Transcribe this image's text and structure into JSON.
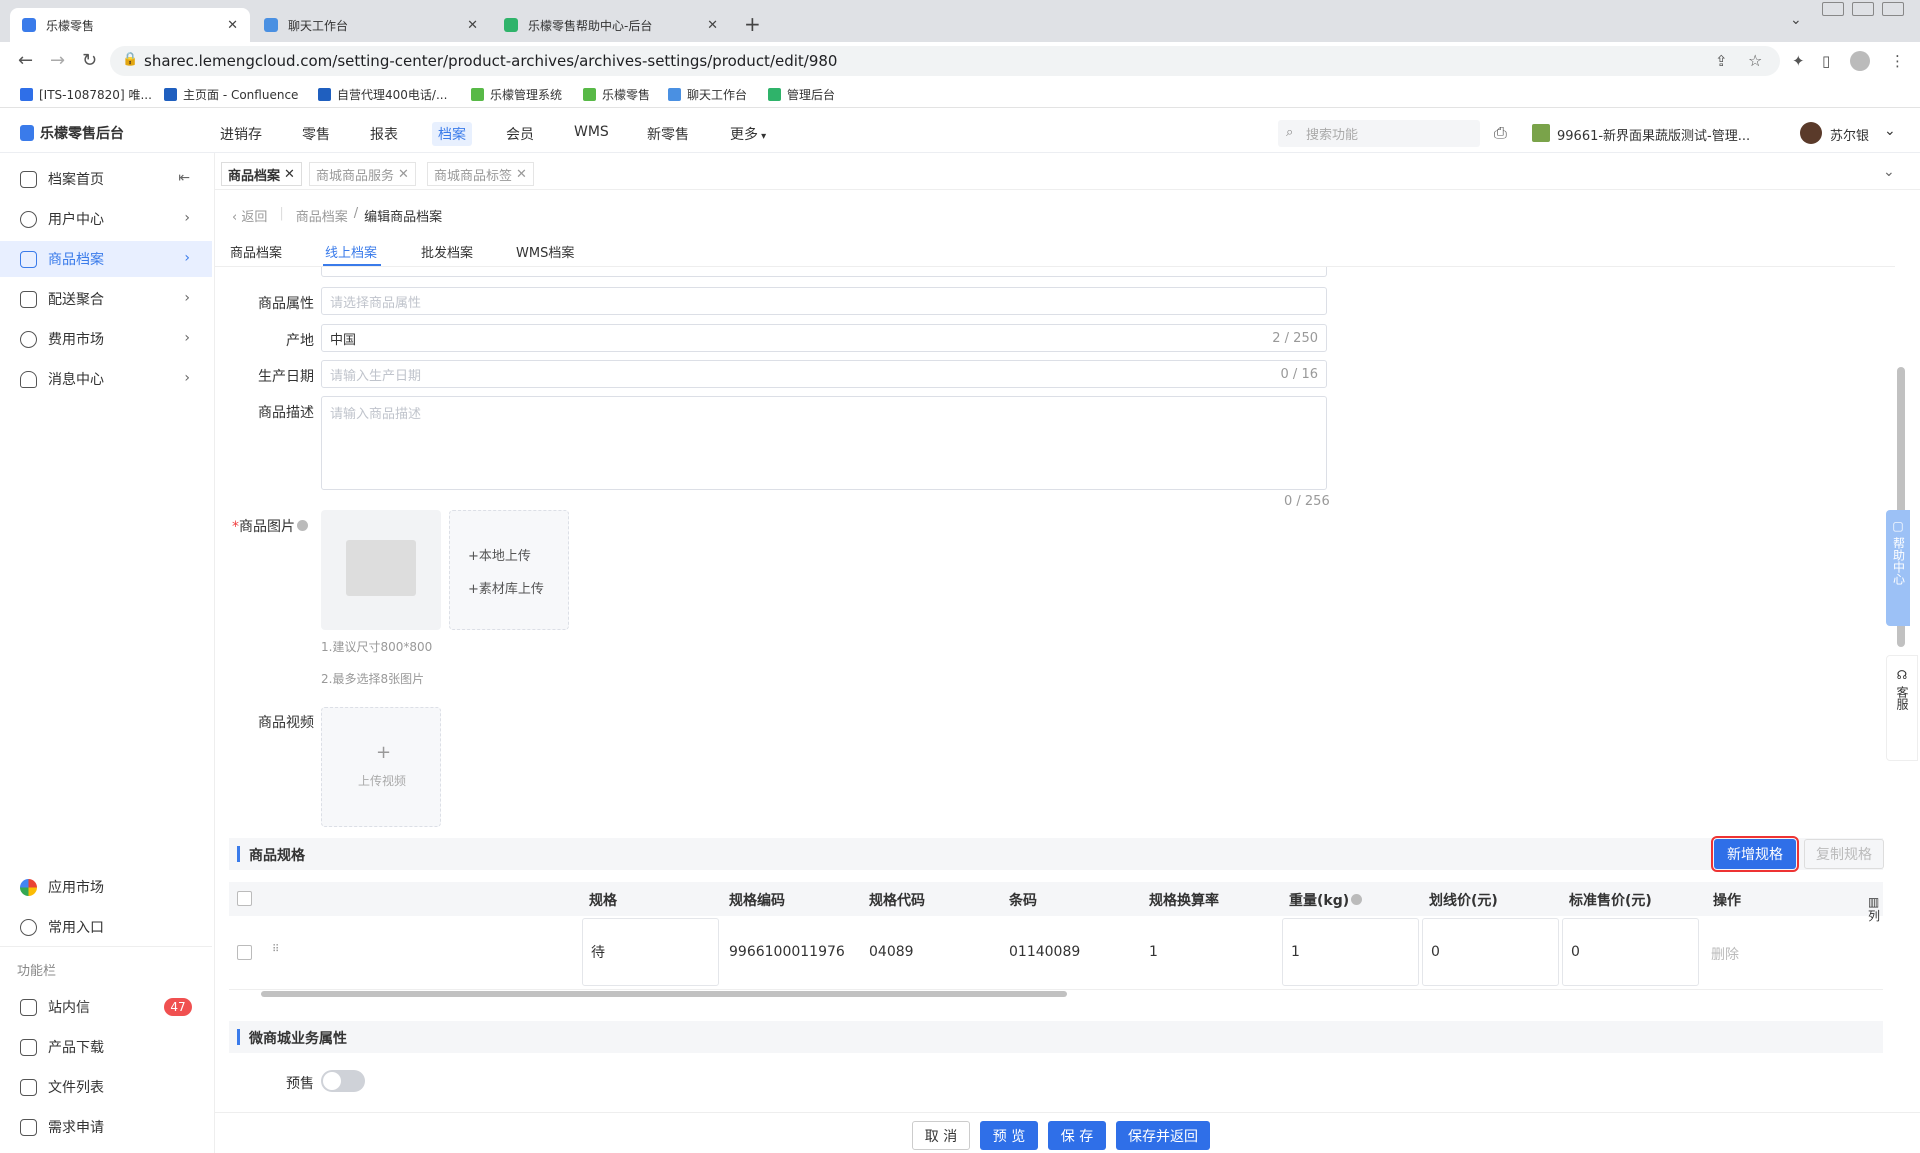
{
  "browser": {
    "tabs": [
      {
        "title": "乐檬零售",
        "active": true
      },
      {
        "title": "聊天工作台",
        "active": false
      },
      {
        "title": "乐檬零售帮助中心-后台",
        "active": false
      }
    ],
    "url": "sharec.lemengcloud.com/setting-center/product-archives/archives-settings/product/edit/980",
    "bookmarks": [
      "[ITS-1087820] 唯...",
      "主页面 - Confluence",
      "自营代理400电话/...",
      "乐檬管理系统",
      "乐檬零售",
      "聊天工作台",
      "管理后台"
    ]
  },
  "app": {
    "logo_text": "乐檬零售后台",
    "top_nav": [
      "进销存",
      "零售",
      "报表",
      "档案",
      "会员",
      "WMS",
      "新零售",
      "更多"
    ],
    "top_nav_active": "档案",
    "search_placeholder": "搜索功能",
    "store_name": "99661-新界面果蔬版测试-管理...",
    "user_name": "苏尔银"
  },
  "sidebar": {
    "items": [
      {
        "label": "档案首页",
        "icon": "home-icon"
      },
      {
        "label": "用户中心",
        "icon": "user-icon"
      },
      {
        "label": "商品档案",
        "icon": "product-icon",
        "active": true
      },
      {
        "label": "配送聚合",
        "icon": "delivery-icon"
      },
      {
        "label": "费用市场",
        "icon": "fee-icon"
      },
      {
        "label": "消息中心",
        "icon": "bell-icon"
      }
    ],
    "bottom_items": [
      {
        "label": "应用市场",
        "icon": "app-market-icon"
      },
      {
        "label": "常用入口",
        "icon": "heart-icon"
      }
    ],
    "func_title": "功能栏",
    "func_items": [
      {
        "label": "站内信",
        "icon": "mail-icon",
        "badge": "47"
      },
      {
        "label": "产品下载",
        "icon": "download-icon"
      },
      {
        "label": "文件列表",
        "icon": "file-list-icon"
      },
      {
        "label": "需求申请",
        "icon": "request-icon"
      }
    ]
  },
  "page_tabs": [
    {
      "label": "商品档案",
      "active": true
    },
    {
      "label": "商城商品服务",
      "active": false
    },
    {
      "label": "商城商品标签",
      "active": false
    }
  ],
  "breadcrumb": {
    "back": "返回",
    "parent": "商品档案",
    "current": "编辑商品档案"
  },
  "sub_tabs": [
    "商品档案",
    "线上档案",
    "批发档案",
    "WMS档案"
  ],
  "sub_tab_active": "线上档案",
  "form": {
    "attr_label": "商品属性",
    "attr_placeholder": "请选择商品属性",
    "origin_label": "产地",
    "origin_value": "中国",
    "origin_count": "2 / 250",
    "date_label": "生产日期",
    "date_placeholder": "请输入生产日期",
    "date_count": "0 / 16",
    "desc_label": "商品描述",
    "desc_placeholder": "请输入商品描述",
    "desc_count": "0 / 256",
    "image_label": "商品图片",
    "image_required": "*",
    "local_upload": "本地上传",
    "library_upload": "素材库上传",
    "image_hint1": "1.建议尺寸800*800",
    "image_hint2": "2.最多选择8张图片",
    "video_label": "商品视频",
    "video_upload": "上传视频"
  },
  "spec_section": {
    "title": "商品规格",
    "add_button": "新增规格",
    "copy_button": "复制规格",
    "columns": [
      "规格",
      "规格编码",
      "规格代码",
      "条码",
      "规格换算率",
      "重量(kg)",
      "划线价(元)",
      "标准售价(元)",
      "操作"
    ],
    "col_setting": "列",
    "rows": [
      {
        "spec": "待",
        "code": "9966100011976",
        "daima": "04089",
        "barcode": "01140089",
        "rate": "1",
        "weight": "1",
        "line_price": "0",
        "price": "0",
        "action": "删除"
      }
    ]
  },
  "wechat_section": {
    "title": "微商城业务属性",
    "presale_label": "预售"
  },
  "footer_buttons": {
    "cancel": "取 消",
    "preview": "预 览",
    "save": "保 存",
    "save_return": "保存并返回"
  },
  "right_float": {
    "help": "帮助中心",
    "service": "客服"
  }
}
